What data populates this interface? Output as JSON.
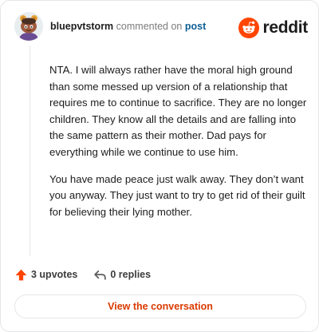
{
  "comment": {
    "username": "bluepvtstorm",
    "action": "commented on",
    "post_link": "post",
    "avatar_icon": "snoo-avatar-icon",
    "paragraphs": [
      "NTA. I will always rather have the moral high ground than some messed up version of a relationship that requires me to continue to sacrifice. They are no longer children. They know all the details and are falling into the same pattern as their mother. Dad pays for everything while we continue to use him.",
      "You have made peace just walk away. They don’t want you anyway. They just want to try to get rid of their guilt for believing their lying mother."
    ]
  },
  "brand": {
    "name": "reddit",
    "icon": "reddit-logo-icon",
    "color": "#ff4500"
  },
  "footer": {
    "upvotes": "3 upvotes",
    "upvote_icon": "upvote-arrow-icon",
    "replies": "0 replies",
    "reply_icon": "reply-arrow-icon"
  },
  "cta": {
    "label": "View the conversation",
    "color": "#d93a00"
  }
}
